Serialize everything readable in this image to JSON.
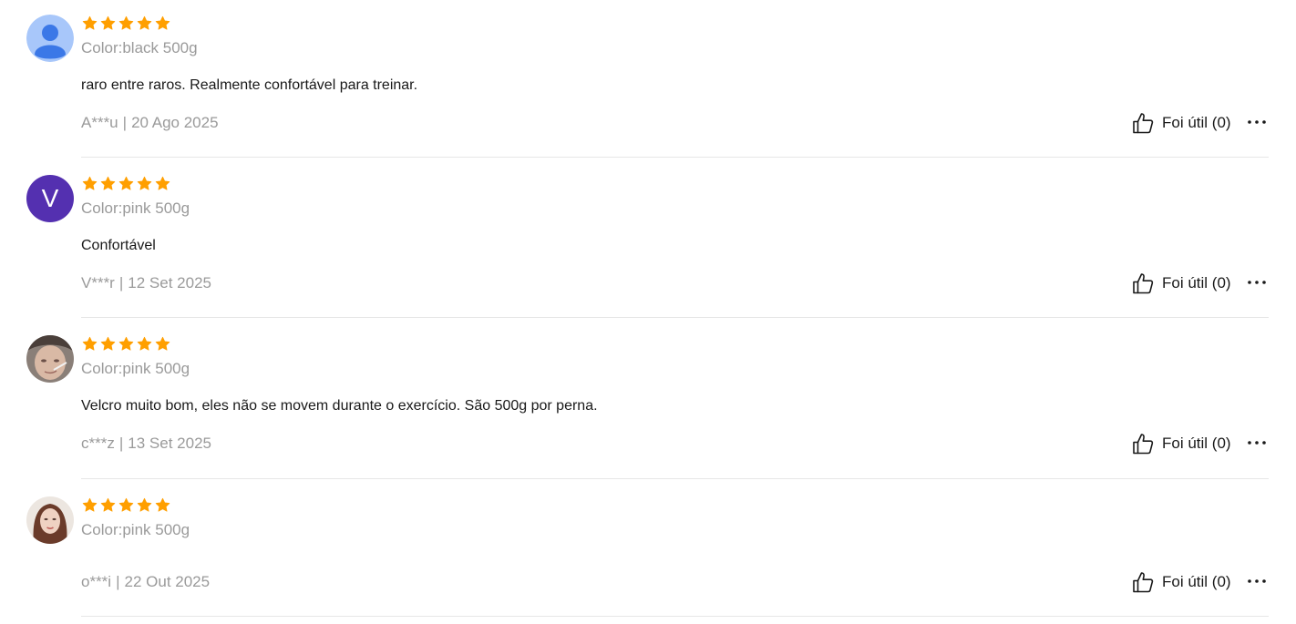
{
  "reviews": [
    {
      "avatar": {
        "kind": "default-person-icon",
        "letter": ""
      },
      "rating": 5,
      "variant": "Color:black 500g",
      "text": "raro entre raros. Realmente confortável para treinar.",
      "author": "A***u",
      "separator": "|",
      "date": "20 Ago 2025",
      "helpful_label": "Foi útil (0)"
    },
    {
      "avatar": {
        "kind": "letter",
        "letter": "V"
      },
      "rating": 5,
      "variant": "Color:pink 500g",
      "text": "Confortável",
      "author": "V***r",
      "separator": "|",
      "date": "12 Set 2025",
      "helpful_label": "Foi útil (0)"
    },
    {
      "avatar": {
        "kind": "user-photo",
        "letter": ""
      },
      "rating": 5,
      "variant": "Color:pink 500g",
      "text": "Velcro muito bom, eles não se movem durante o exercício. São 500g por perna.",
      "author": "c***z",
      "separator": "|",
      "date": "13 Set 2025",
      "helpful_label": "Foi útil (0)"
    },
    {
      "avatar": {
        "kind": "user-photo",
        "letter": ""
      },
      "rating": 5,
      "variant": "Color:pink 500g",
      "text": "",
      "author": "o***i",
      "separator": "|",
      "date": "22 Out 2025",
      "helpful_label": "Foi útil (0)"
    }
  ],
  "colors": {
    "star": "#ff9f00",
    "muted_text": "#9a9a9a",
    "text": "#191919",
    "divider": "#e6e6e6",
    "letter_avatar": "#5430b0",
    "default_avatar_bg": "#a8c7fa",
    "default_avatar_fg": "#3b78e7"
  },
  "icons": {
    "star": "star-icon",
    "helpful": "thumbs-up-icon",
    "more": "more-options-icon"
  }
}
